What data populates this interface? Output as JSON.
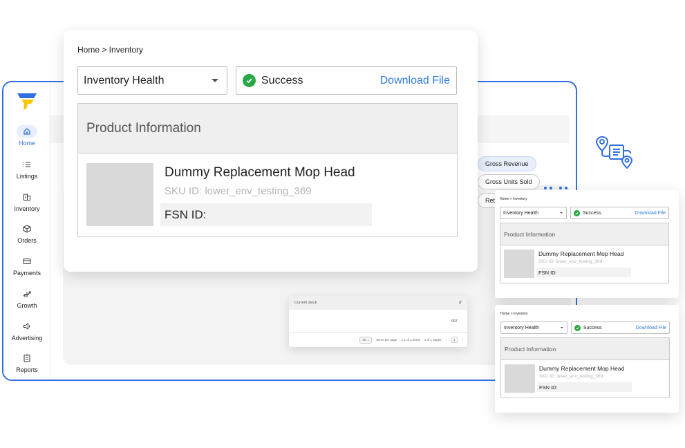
{
  "sidebar": {
    "items": [
      {
        "label": "Home",
        "icon": "home-icon",
        "active": true
      },
      {
        "label": "Listings",
        "icon": "list-icon"
      },
      {
        "label": "Inventory",
        "icon": "building-icon"
      },
      {
        "label": "Orders",
        "icon": "package-icon"
      },
      {
        "label": "Payments",
        "icon": "card-icon"
      },
      {
        "label": "Growth",
        "icon": "growth-icon"
      },
      {
        "label": "Advertising",
        "icon": "megaphone-icon"
      },
      {
        "label": "Reports",
        "icon": "report-icon"
      }
    ]
  },
  "metrics": {
    "chips": [
      "Gross Revenue",
      "Gross Units Sold",
      "Retu"
    ]
  },
  "main_card": {
    "breadcrumb": "Home >  Inventory",
    "dropdown_value": "Inventory Health",
    "status_text": "Success",
    "download_label": "Download File",
    "section_title": "Product Information",
    "product_name": "Dummy Replacement Mop Head",
    "sku": "SKU ID: lower_env_testing_369",
    "fsn": "FSN ID:"
  },
  "card_two": {
    "breadcrumb": "Home >  Inventory",
    "dropdown_value": "Inventory Health",
    "status_text": "Success",
    "download_label": "Download File",
    "section_title": "Product Information",
    "product_name": "Dummy Replacement Mop Head",
    "sku": "SKU ID: lower_env_testing_369",
    "fsn": "FSN ID:"
  },
  "card_three": {
    "breadcrumb": "Home >  Inventory",
    "dropdown_value": "Inventory Health",
    "status_text": "Success",
    "download_label": "Download File",
    "section_title": "Product Information",
    "product_name": "Dummy Replacement Mop Head",
    "sku": "SKU ID: lower_env_testing_369",
    "fsn": "FSN ID:"
  },
  "stock_table": {
    "header": "Current stock",
    "value": "997",
    "page_size": "30",
    "items_per_page_label": "Items per page",
    "range_label": "1-1 of 1 items",
    "pages_label": "1 of 1 pages",
    "current_page": "1"
  },
  "colors": {
    "accent": "#2f6fe0",
    "success": "#27a844",
    "link": "#2f7ae0",
    "logo_yellow": "#f7c600"
  }
}
